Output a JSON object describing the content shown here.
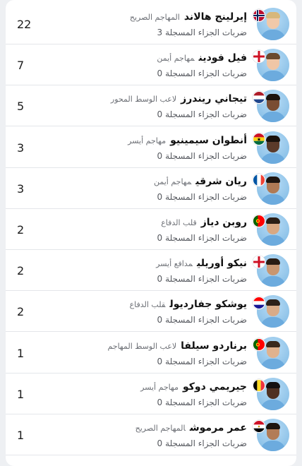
{
  "players": [
    {
      "count": "22",
      "name": "إيرلينج هالاند",
      "position": "المهاجم الصريح",
      "stat_label": "ضربات الجزاء المسجلة",
      "stat_value": "3",
      "flag": "norway-flag",
      "skin": "#f1c9a9",
      "hair": "#d7b77a"
    },
    {
      "count": "7",
      "name": "فيل فودين",
      "position": "مهاجم أيمن",
      "stat_label": "ضربات الجزاء المسجلة",
      "stat_value": "0",
      "flag": "england-flag",
      "skin": "#f0c6a6",
      "hair": "#6a4a2f"
    },
    {
      "count": "5",
      "name": "تيجاني ريندرز",
      "position": "لاعب الوسط المحور",
      "stat_label": "ضربات الجزاء المسجلة",
      "stat_value": "0",
      "flag": "netherlands-flag",
      "skin": "#7a4d33",
      "hair": "#1c130e"
    },
    {
      "count": "3",
      "name": "أنطوان سيمينيو",
      "position": "مهاجم أيسر",
      "stat_label": "ضربات الجزاء المسجلة",
      "stat_value": "0",
      "flag": "ghana-flag",
      "skin": "#5b3a2a",
      "hair": "#1a120d"
    },
    {
      "count": "3",
      "name": "ريان شرقي",
      "position": "مهاجم أيمن",
      "stat_label": "ضربات الجزاء المسجلة",
      "stat_value": "0",
      "flag": "france-flag",
      "skin": "#b07a55",
      "hair": "#1f1611"
    },
    {
      "count": "2",
      "name": "روبن دياز",
      "position": "قلب الدفاع",
      "stat_label": "ضربات الجزاء المسجلة",
      "stat_value": "0",
      "flag": "portugal-flag",
      "skin": "#d9a882",
      "hair": "#2b1e15"
    },
    {
      "count": "2",
      "name": "نيكو أوريلي",
      "position": "مدافع أيسر",
      "stat_label": "ضربات الجزاء المسجلة",
      "stat_value": "0",
      "flag": "england-flag",
      "skin": "#c99670",
      "hair": "#2a1c13"
    },
    {
      "count": "2",
      "name": "يوشكو جفارديول",
      "position": "قلب الدفاع",
      "stat_label": "ضربات الجزاء المسجلة",
      "stat_value": "0",
      "flag": "croatia-flag",
      "skin": "#d9ab88",
      "hair": "#2c2019"
    },
    {
      "count": "1",
      "name": "برناردو سيلفا",
      "position": "لاعب الوسط المهاجم",
      "stat_label": "ضربات الجزاء المسجلة",
      "stat_value": "0",
      "flag": "portugal-flag",
      "skin": "#e0b28e",
      "hair": "#3a291d"
    },
    {
      "count": "1",
      "name": "جيريمي دوكو",
      "position": "مهاجم أيسر",
      "stat_label": "ضربات الجزاء المسجلة",
      "stat_value": "0",
      "flag": "belgium-flag",
      "skin": "#4f3122",
      "hair": "#141010"
    },
    {
      "count": "1",
      "name": "عمر مرموش",
      "position": "المهاجم الصريح",
      "stat_label": "ضربات الجزاء المسجلة",
      "stat_value": "0",
      "flag": "egypt-flag",
      "skin": "#b27c57",
      "hair": "#1c140f"
    }
  ]
}
